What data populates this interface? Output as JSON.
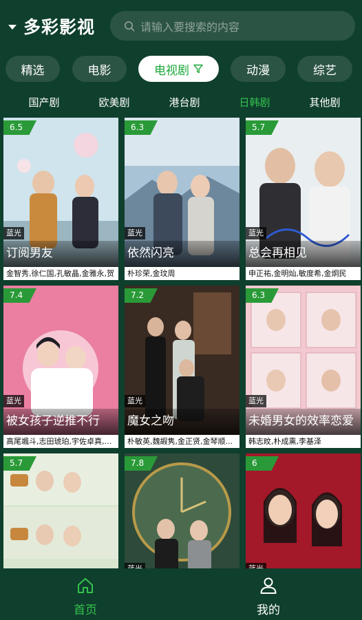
{
  "header": {
    "app_title": "多彩影视",
    "search_placeholder": "请输入要搜索的内容"
  },
  "categories": [
    {
      "label": "精选",
      "active": false
    },
    {
      "label": "电影",
      "active": false
    },
    {
      "label": "电视剧",
      "active": true
    },
    {
      "label": "动漫",
      "active": false
    },
    {
      "label": "综艺",
      "active": false
    }
  ],
  "subcategories": [
    {
      "label": "国产剧",
      "active": false
    },
    {
      "label": "欧美剧",
      "active": false
    },
    {
      "label": "港台剧",
      "active": false
    },
    {
      "label": "日韩剧",
      "active": true
    },
    {
      "label": "其他剧",
      "active": false
    }
  ],
  "cards": [
    {
      "rating": "6.5",
      "badge": "蓝光",
      "title": "订阅男友",
      "cast": "金智秀,徐仁国,孔敏晶,金雅永,贺"
    },
    {
      "rating": "6.3",
      "badge": "蓝光",
      "title": "依然闪亮",
      "cast": "朴珍荣,金玟周"
    },
    {
      "rating": "5.7",
      "badge": "蓝光",
      "title": "总会再相见",
      "cast": "申正祐,金明灿,敏度希,金炯民"
    },
    {
      "rating": "7.4",
      "badge": "蓝光",
      "title": "被女孩子逆推不行",
      "cast": "高尾颯斗,志田琥珀,宇佐卓真,世..."
    },
    {
      "rating": "7.2",
      "badge": "蓝光",
      "title": "魔女之吻",
      "cast": "朴敏英,魏嘏隽,金正贤,金琴顺..."
    },
    {
      "rating": "6.3",
      "badge": "蓝光",
      "title": "未婚男女的效率恋爱",
      "cast": "韩志旼,朴成熏,李基泽"
    },
    {
      "rating": "5.7",
      "badge": "",
      "title": "",
      "cast": ""
    },
    {
      "rating": "7.8",
      "badge": "蓝光",
      "title": "",
      "cast": ""
    },
    {
      "rating": "6",
      "badge": "蓝光",
      "title": "",
      "cast": ""
    }
  ],
  "nav": [
    {
      "label": "首页",
      "icon": "home-icon",
      "active": true
    },
    {
      "label": "我的",
      "icon": "user-icon",
      "active": false
    }
  ],
  "colors": {
    "background": "#0f3f2d",
    "accent": "#34c24d",
    "pill": "#2c5445",
    "rating": "#2a9a38"
  }
}
